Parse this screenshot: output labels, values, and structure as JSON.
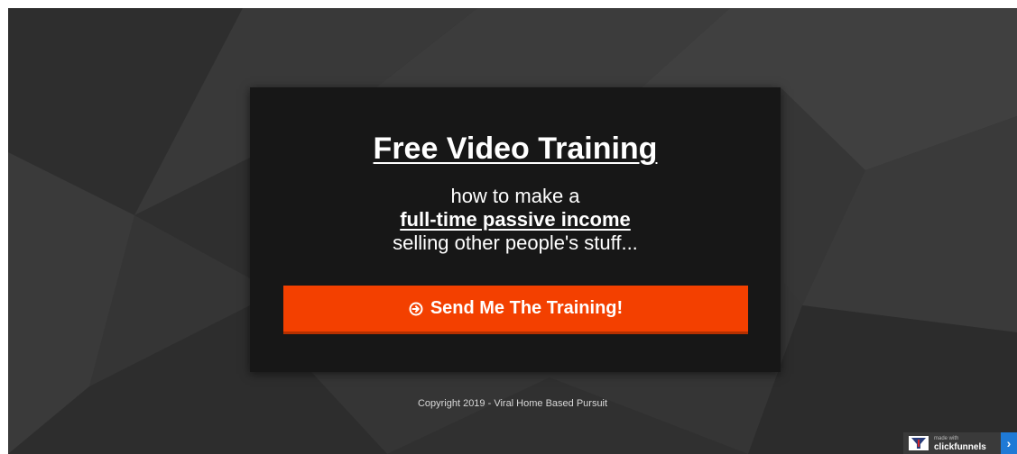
{
  "hero": {
    "headline": "Free Video Training",
    "subline_1": "how to make a",
    "subline_2": "full-time passive income",
    "subline_3": "selling other people's stuff...",
    "cta_label": "Send Me The Training!"
  },
  "footer": {
    "copyright": "Copyright 2019 - Viral Home Based Pursuit"
  },
  "badge": {
    "small_text": "made with",
    "brand": "clickfunnels"
  },
  "colors": {
    "background": "#333333",
    "card": "#171717",
    "cta": "#f34000",
    "badge_accent": "#1f7ad6"
  },
  "icons": {
    "cta_icon": "circle-arrow-right-icon",
    "badge_logo": "clickfunnels-logo-icon",
    "badge_chevron": "chevron-right-icon"
  }
}
